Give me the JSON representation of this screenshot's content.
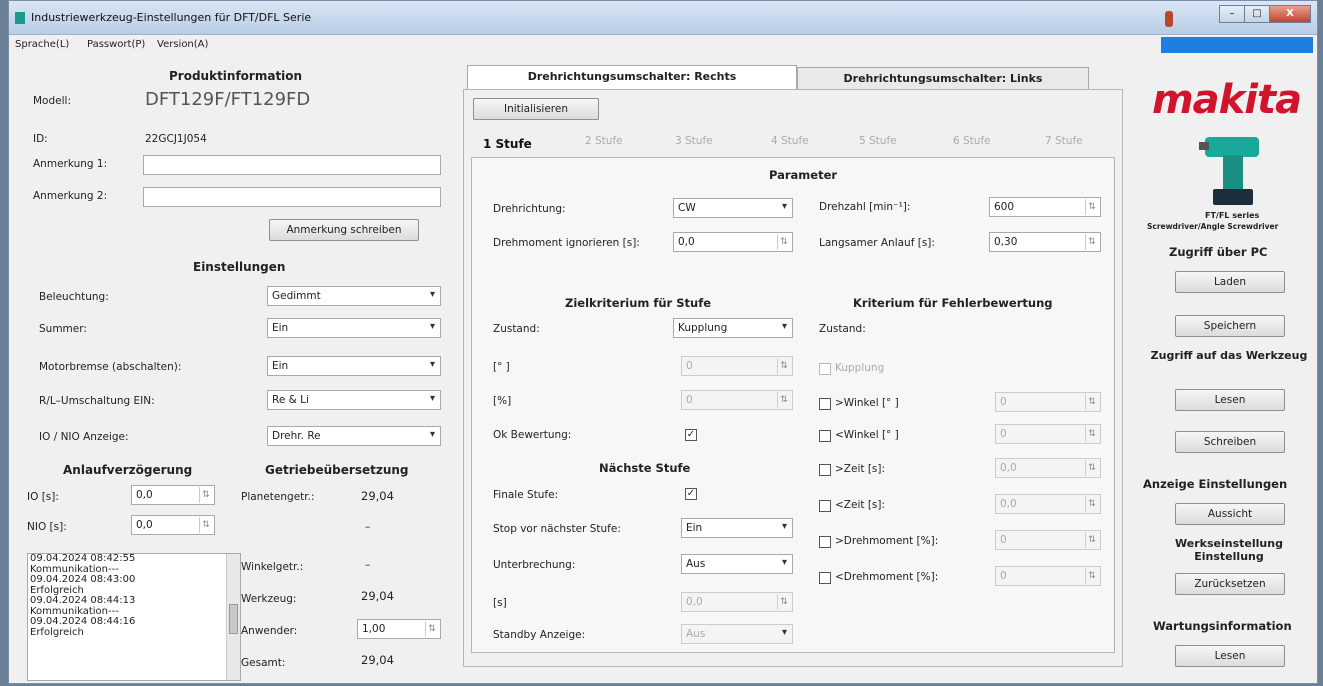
{
  "window": {
    "title": "Industriewerkzeug-Einstellungen für DFT/DFL Serie",
    "minimize": "–",
    "maximize": "□",
    "close": "X"
  },
  "menu": {
    "sprache": "Sprache(L)",
    "passwort": "Passwort(P)",
    "version": "Version(A)"
  },
  "produkt": {
    "heading": "Produktinformation",
    "modell_label": "Modell:",
    "modell_value": "DFT129F/FT129FD",
    "id_label": "ID:",
    "id_value": "22GCJ1J054",
    "anm1_label": "Anmerkung 1:",
    "anm2_label": "Anmerkung 2:",
    "anm1_value": "",
    "anm2_value": "",
    "write_button": "Anmerkung schreiben"
  },
  "einstellungen": {
    "heading": "Einstellungen",
    "rows": [
      {
        "label": "Beleuchtung:",
        "value": "Gedimmt"
      },
      {
        "label": "Summer:",
        "value": "Ein"
      },
      {
        "label": "Motorbremse (abschalten):",
        "value": "Ein"
      },
      {
        "label": "R/L–Umschaltung EIN:",
        "value": "Re & Li"
      },
      {
        "label": "IO / NIO Anzeige:",
        "value": "Drehr. Re"
      }
    ]
  },
  "anlauf": {
    "heading": "Anlaufverzögerung",
    "io_label": "IO [s]:",
    "io_value": "0,0",
    "nio_label": "NIO [s]:",
    "nio_value": "0,0"
  },
  "getriebe": {
    "heading": "Getriebeübersetzung",
    "planeten_label": "Planetengetr.:",
    "planeten_value": "29,04",
    "dash1": "–",
    "winkel_label": "Winkelgetr.:",
    "winkel_value": "–",
    "werkzeug_label": "Werkzeug:",
    "werkzeug_value": "29,04",
    "anwender_label": "Anwender:",
    "anwender_value": "1,00",
    "gesamt_label": "Gesamt:",
    "gesamt_value": "29,04"
  },
  "log": [
    "09.04.2024 08:42:55",
    " Kommunikation---",
    "09.04.2024 08:43:00",
    " Erfolgreich",
    "09.04.2024 08:44:13",
    " Kommunikation---",
    "09.04.2024 08:44:16",
    " Erfolgreich"
  ],
  "center": {
    "tab_right": "Drehrichtungsumschalter: Rechts",
    "tab_left": "Drehrichtungsumschalter: Links",
    "init_button": "Initialisieren",
    "stages": [
      "1 Stufe",
      "2 Stufe",
      "3 Stufe",
      "4 Stufe",
      "5 Stufe",
      "6 Stufe",
      "7 Stufe"
    ],
    "param_heading": "Parameter",
    "drehrichtung_label": "Drehrichtung:",
    "drehrichtung_value": "CW",
    "drehmoment_ign_label": "Drehmoment ignorieren [s]:",
    "drehmoment_ign_value": "0,0",
    "drehzahl_label": "Drehzahl [min⁻¹]:",
    "drehzahl_value": "600",
    "anlauf_label": "Langsamer Anlauf [s]:",
    "anlauf_value": "0,30",
    "ziel_heading": "Zielkriterium für Stufe",
    "zustand_label": "Zustand:",
    "zustand_value": "Kupplung",
    "deg_label": "[° ]",
    "deg_value": "0",
    "pct_label": "[%]",
    "pct_value": "0",
    "ok_label": "Ok Bewertung:",
    "naechste_heading": "Nächste Stufe",
    "finale_label": "Finale Stufe:",
    "stop_label": "Stop vor nächster Stufe:",
    "stop_value": "Ein",
    "unterbrechung_label": "Unterbrechung:",
    "unterbrechung_value": "Aus",
    "s_label": "[s]",
    "s_value": "0,0",
    "standby_label": "Standby Anzeige:",
    "standby_value": "Aus",
    "fehler_heading": "Kriterium für Fehlerbewertung",
    "fehler_zustand_label": "Zustand:",
    "kupplung_label": "Kupplung",
    "fehler_rows": [
      {
        "label": ">Winkel [° ]",
        "value": "0"
      },
      {
        "label": "<Winkel [° ]",
        "value": "0"
      },
      {
        "label": ">Zeit [s]:",
        "value": "0,0"
      },
      {
        "label": "<Zeit [s]:",
        "value": "0,0"
      },
      {
        "label": ">Drehmoment [%]:",
        "value": "0"
      },
      {
        "label": "<Drehmoment [%]:",
        "value": "0"
      }
    ]
  },
  "right": {
    "logo": "makita",
    "series": "FT/FL series",
    "series_sub": "Screwdriver/Angle Screwdriver",
    "pc_heading": "Zugriff über PC",
    "laden": "Laden",
    "speichern": "Speichern",
    "werkzeug_heading": "Zugriff auf das Werkzeug",
    "lesen1": "Lesen",
    "schreiben": "Schreiben",
    "anzeige_heading": "Anzeige Einstellungen",
    "aussicht": "Aussicht",
    "werks_heading": "Werkseinstellung Einstellung",
    "zuruecksetzen": "Zurücksetzen",
    "wartung_heading": "Wartungsinformation",
    "lesen2": "Lesen",
    "colors": {
      "brand": "#d0142c",
      "tool_teal": "#1aa89a",
      "menu_accent": "#1e7fe0"
    }
  }
}
